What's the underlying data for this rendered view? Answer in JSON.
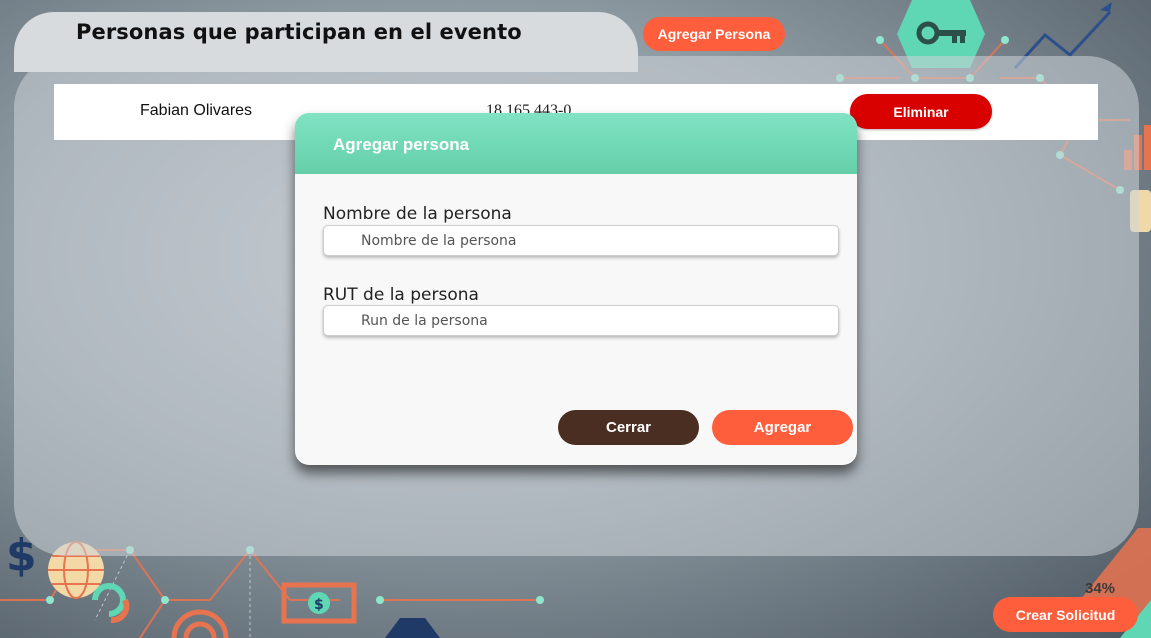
{
  "page": {
    "title": "Personas que participan en el evento",
    "add_person_label": "Agregar Persona"
  },
  "participants": [
    {
      "name": "Fabian Olivares",
      "rut": "18.165.443-0",
      "delete_label": "Eliminar"
    }
  ],
  "modal": {
    "title": "Agregar persona",
    "name_label": "Nombre de la persona",
    "name_value": "",
    "name_placeholder": "Nombre de la persona",
    "rut_label": "RUT de la persona",
    "rut_value": "",
    "rut_placeholder": "Run de la persona",
    "close_label": "Cerrar",
    "add_label": "Agregar"
  },
  "footer": {
    "progress_text": "34%",
    "create_request_label": "Crear Solicitud"
  },
  "colors": {
    "accent_orange": "#fe5e3b",
    "danger_red": "#d90000",
    "modal_header_green": "#7ee0c0",
    "dark_brown": "#4a2e22",
    "icon_teal": "#5fd6b4"
  },
  "icons": [
    "key-icon",
    "dollar-icon",
    "globe-icon",
    "refresh-icon",
    "banknote-icon",
    "growth-chart-icon",
    "target-icon",
    "card-icon"
  ]
}
